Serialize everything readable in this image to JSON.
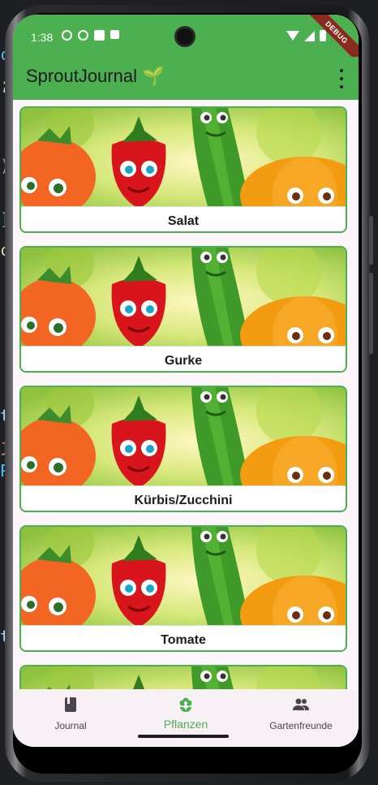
{
  "status_bar": {
    "time": "1:38",
    "debug_banner": "DEBUG"
  },
  "app_bar": {
    "title": "SproutJournal 🌱"
  },
  "plants": [
    {
      "label": "Salat"
    },
    {
      "label": "Gurke"
    },
    {
      "label": "Kürbis/Zucchini"
    },
    {
      "label": "Tomate"
    },
    {
      "label": ""
    }
  ],
  "bottom_nav": {
    "items": [
      {
        "label": "Journal",
        "icon": "book-icon"
      },
      {
        "label": "Pflanzen",
        "icon": "flower-icon",
        "active": true
      },
      {
        "label": "Gartenfreunde",
        "icon": "people-icon"
      }
    ]
  },
  "colors": {
    "primary": "#4caf50",
    "surface": "#fdf7fb",
    "nav_background": "#f7f0f5",
    "debug_ribbon": "#8a2a1f"
  }
}
